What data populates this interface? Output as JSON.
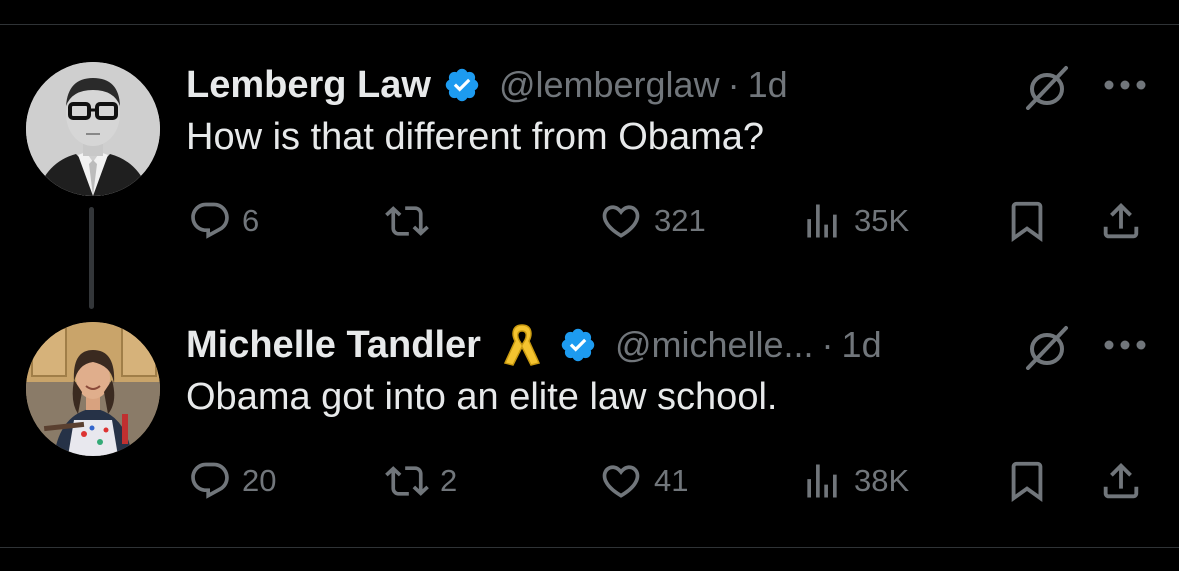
{
  "colors": {
    "background": "#000000",
    "text_primary": "#e7e9ea",
    "text_secondary": "#71767b",
    "verified_blue": "#1d9bf0",
    "divider": "#2f3336",
    "ribbon_gold": "#f4c430"
  },
  "tweets": [
    {
      "author_name": "Lemberg Law",
      "verified": true,
      "handle": "@lemberglaw",
      "separator": "·",
      "time": "1d",
      "text": "How is that different from Obama?",
      "replies": "6",
      "reposts": "",
      "likes": "321",
      "views": "35K",
      "avatar": "lemberg-law-avatar"
    },
    {
      "author_name": "Michelle Tandler",
      "name_emoji": "yellow-ribbon-icon",
      "verified": true,
      "handle": "@michelle...",
      "separator": "·",
      "time": "1d",
      "text": "Obama got into an elite law school.",
      "replies": "20",
      "reposts": "2",
      "likes": "41",
      "views": "38K",
      "avatar": "michelle-tandler-avatar"
    }
  ],
  "icons": {
    "reply": "reply-icon",
    "repost": "repost-icon",
    "like": "heart-icon",
    "views": "views-icon",
    "bookmark": "bookmark-icon",
    "share": "share-icon",
    "grok": "grok-icon",
    "more": "more-icon"
  }
}
